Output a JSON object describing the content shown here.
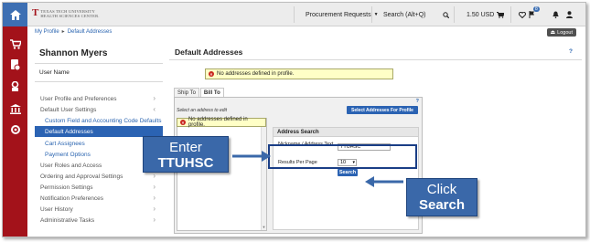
{
  "topbar": {
    "logo_line1": "TEXAS TECH UNIVERSITY",
    "logo_line2": "HEALTH SCIENCES CENTER.",
    "procurement_label": "Procurement Requests",
    "search_label": "Search (Alt+Q)",
    "cart_amount": "1.50 USD",
    "notification_count": "8"
  },
  "breadcrumb": {
    "item1": "My Profile",
    "separator": "▸",
    "item2": "Default Addresses"
  },
  "logout_label": "Logout",
  "leftnav": {
    "user_name": "Shannon Myers",
    "user_label": "User Name",
    "items": [
      {
        "label": "User Profile and Preferences"
      },
      {
        "label": "Default User Settings"
      },
      {
        "label": "Custom Field and Accounting Code Defaults"
      },
      {
        "label": "Default Addresses"
      },
      {
        "label": "Cart Assignees"
      },
      {
        "label": "Payment Options"
      },
      {
        "label": "User Roles and Access"
      },
      {
        "label": "Ordering and Approval Settings"
      },
      {
        "label": "Permission Settings"
      },
      {
        "label": "Notification Preferences"
      },
      {
        "label": "User History"
      },
      {
        "label": "Administrative Tasks"
      }
    ]
  },
  "main": {
    "title": "Default Addresses",
    "help": "?",
    "warning": "No addresses defined in profile.",
    "tabs": [
      {
        "label": "Ship To"
      },
      {
        "label": "Bill To"
      }
    ],
    "panel_help": "?",
    "select_prompt": "Select an address to edit",
    "select_button": "Select Addresses For Profile",
    "panel_warning": "No addresses defined in profile.",
    "address_search": {
      "title": "Address Search",
      "nickname_label": "Nickname / Address Text",
      "nickname_value": "TTUHSC",
      "rpp_label": "Results Per Page",
      "rpp_value": "10",
      "search_button": "Search"
    }
  },
  "callouts": {
    "enter": {
      "line1": "Enter",
      "line2": "TTUHSC"
    },
    "click": {
      "line1": "Click",
      "line2": "Search"
    }
  },
  "colors": {
    "brand_red": "#a3121a",
    "accent_blue": "#2b63b3",
    "callout_blue": "#3a68a9"
  }
}
